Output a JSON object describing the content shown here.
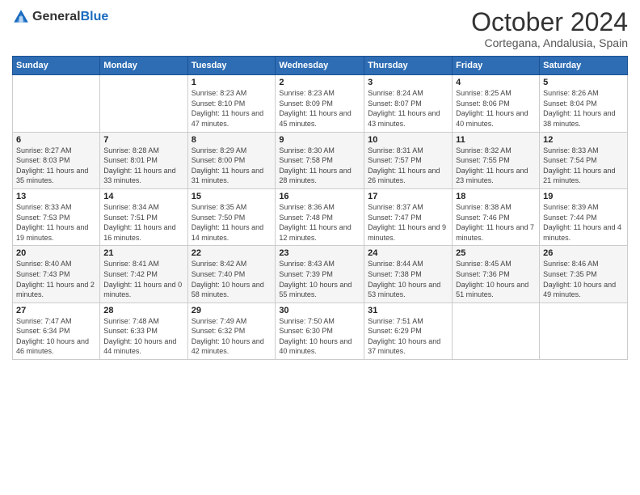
{
  "header": {
    "logo_general": "General",
    "logo_blue": "Blue",
    "month": "October 2024",
    "location": "Cortegana, Andalusia, Spain"
  },
  "weekdays": [
    "Sunday",
    "Monday",
    "Tuesday",
    "Wednesday",
    "Thursday",
    "Friday",
    "Saturday"
  ],
  "weeks": [
    [
      {
        "day": "",
        "info": ""
      },
      {
        "day": "",
        "info": ""
      },
      {
        "day": "1",
        "info": "Sunrise: 8:23 AM\nSunset: 8:10 PM\nDaylight: 11 hours and 47 minutes."
      },
      {
        "day": "2",
        "info": "Sunrise: 8:23 AM\nSunset: 8:09 PM\nDaylight: 11 hours and 45 minutes."
      },
      {
        "day": "3",
        "info": "Sunrise: 8:24 AM\nSunset: 8:07 PM\nDaylight: 11 hours and 43 minutes."
      },
      {
        "day": "4",
        "info": "Sunrise: 8:25 AM\nSunset: 8:06 PM\nDaylight: 11 hours and 40 minutes."
      },
      {
        "day": "5",
        "info": "Sunrise: 8:26 AM\nSunset: 8:04 PM\nDaylight: 11 hours and 38 minutes."
      }
    ],
    [
      {
        "day": "6",
        "info": "Sunrise: 8:27 AM\nSunset: 8:03 PM\nDaylight: 11 hours and 35 minutes."
      },
      {
        "day": "7",
        "info": "Sunrise: 8:28 AM\nSunset: 8:01 PM\nDaylight: 11 hours and 33 minutes."
      },
      {
        "day": "8",
        "info": "Sunrise: 8:29 AM\nSunset: 8:00 PM\nDaylight: 11 hours and 31 minutes."
      },
      {
        "day": "9",
        "info": "Sunrise: 8:30 AM\nSunset: 7:58 PM\nDaylight: 11 hours and 28 minutes."
      },
      {
        "day": "10",
        "info": "Sunrise: 8:31 AM\nSunset: 7:57 PM\nDaylight: 11 hours and 26 minutes."
      },
      {
        "day": "11",
        "info": "Sunrise: 8:32 AM\nSunset: 7:55 PM\nDaylight: 11 hours and 23 minutes."
      },
      {
        "day": "12",
        "info": "Sunrise: 8:33 AM\nSunset: 7:54 PM\nDaylight: 11 hours and 21 minutes."
      }
    ],
    [
      {
        "day": "13",
        "info": "Sunrise: 8:33 AM\nSunset: 7:53 PM\nDaylight: 11 hours and 19 minutes."
      },
      {
        "day": "14",
        "info": "Sunrise: 8:34 AM\nSunset: 7:51 PM\nDaylight: 11 hours and 16 minutes."
      },
      {
        "day": "15",
        "info": "Sunrise: 8:35 AM\nSunset: 7:50 PM\nDaylight: 11 hours and 14 minutes."
      },
      {
        "day": "16",
        "info": "Sunrise: 8:36 AM\nSunset: 7:48 PM\nDaylight: 11 hours and 12 minutes."
      },
      {
        "day": "17",
        "info": "Sunrise: 8:37 AM\nSunset: 7:47 PM\nDaylight: 11 hours and 9 minutes."
      },
      {
        "day": "18",
        "info": "Sunrise: 8:38 AM\nSunset: 7:46 PM\nDaylight: 11 hours and 7 minutes."
      },
      {
        "day": "19",
        "info": "Sunrise: 8:39 AM\nSunset: 7:44 PM\nDaylight: 11 hours and 4 minutes."
      }
    ],
    [
      {
        "day": "20",
        "info": "Sunrise: 8:40 AM\nSunset: 7:43 PM\nDaylight: 11 hours and 2 minutes."
      },
      {
        "day": "21",
        "info": "Sunrise: 8:41 AM\nSunset: 7:42 PM\nDaylight: 11 hours and 0 minutes."
      },
      {
        "day": "22",
        "info": "Sunrise: 8:42 AM\nSunset: 7:40 PM\nDaylight: 10 hours and 58 minutes."
      },
      {
        "day": "23",
        "info": "Sunrise: 8:43 AM\nSunset: 7:39 PM\nDaylight: 10 hours and 55 minutes."
      },
      {
        "day": "24",
        "info": "Sunrise: 8:44 AM\nSunset: 7:38 PM\nDaylight: 10 hours and 53 minutes."
      },
      {
        "day": "25",
        "info": "Sunrise: 8:45 AM\nSunset: 7:36 PM\nDaylight: 10 hours and 51 minutes."
      },
      {
        "day": "26",
        "info": "Sunrise: 8:46 AM\nSunset: 7:35 PM\nDaylight: 10 hours and 49 minutes."
      }
    ],
    [
      {
        "day": "27",
        "info": "Sunrise: 7:47 AM\nSunset: 6:34 PM\nDaylight: 10 hours and 46 minutes."
      },
      {
        "day": "28",
        "info": "Sunrise: 7:48 AM\nSunset: 6:33 PM\nDaylight: 10 hours and 44 minutes."
      },
      {
        "day": "29",
        "info": "Sunrise: 7:49 AM\nSunset: 6:32 PM\nDaylight: 10 hours and 42 minutes."
      },
      {
        "day": "30",
        "info": "Sunrise: 7:50 AM\nSunset: 6:30 PM\nDaylight: 10 hours and 40 minutes."
      },
      {
        "day": "31",
        "info": "Sunrise: 7:51 AM\nSunset: 6:29 PM\nDaylight: 10 hours and 37 minutes."
      },
      {
        "day": "",
        "info": ""
      },
      {
        "day": "",
        "info": ""
      }
    ]
  ]
}
